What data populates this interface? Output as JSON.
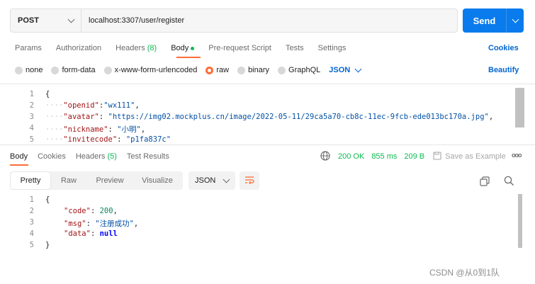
{
  "request": {
    "method": "POST",
    "url": "localhost:3307/user/register",
    "send_label": "Send"
  },
  "request_tabs": {
    "params": "Params",
    "authorization": "Authorization",
    "headers_label": "Headers",
    "headers_count": "(8)",
    "body": "Body",
    "prerequest": "Pre-request Script",
    "tests": "Tests",
    "settings": "Settings",
    "cookies": "Cookies"
  },
  "body_types": {
    "none": "none",
    "form_data": "form-data",
    "urlencoded": "x-www-form-urlencoded",
    "raw": "raw",
    "binary": "binary",
    "graphql": "GraphQL",
    "language": "JSON",
    "beautify": "Beautify"
  },
  "request_body": {
    "line_numbers": [
      "1",
      "2",
      "3",
      "4",
      "5"
    ],
    "open_brace": "{",
    "ws": "····",
    "k1": "\"openid\"",
    "v1": "\"wx111\"",
    "k2": "\"avatar\"",
    "v2": "\"https://img02.mockplus.cn/image/2022-05-11/29ca5a70-cb8c-11ec-9fcb-ede013bc170a.jpg\"",
    "k3": "\"nickname\"",
    "v3": "\"小明\"",
    "k4": "\"invitecode\"",
    "v4": "\"p1fa837c\""
  },
  "response_tabs": {
    "body": "Body",
    "cookies": "Cookies",
    "headers_label": "Headers",
    "headers_count": "(5)",
    "test_results": "Test Results",
    "status": "200 OK",
    "time": "855 ms",
    "size": "209 B",
    "save_example": "Save as Example",
    "more": "ooo"
  },
  "response_view": {
    "pretty": "Pretty",
    "raw": "Raw",
    "preview": "Preview",
    "visualize": "Visualize",
    "format": "JSON"
  },
  "response_body": {
    "line_numbers": [
      "1",
      "2",
      "3",
      "4",
      "5"
    ],
    "open_brace": "{",
    "close_brace": "}",
    "k1": "\"code\"",
    "v1": "200",
    "k2": "\"msg\"",
    "v2": "\"注册成功\"",
    "k3": "\"data\"",
    "v3": "null"
  },
  "watermark": "CSDN @从0到1队",
  "colors": {
    "accent_orange": "#ff6c37",
    "send_blue": "#097bed",
    "link_blue": "#0265d2",
    "status_green": "#0cbb52"
  },
  "icons": [
    "chevron-down-icon",
    "globe-icon",
    "save-icon",
    "more-icon",
    "wrap-lines-icon",
    "copy-icon",
    "search-icon"
  ]
}
